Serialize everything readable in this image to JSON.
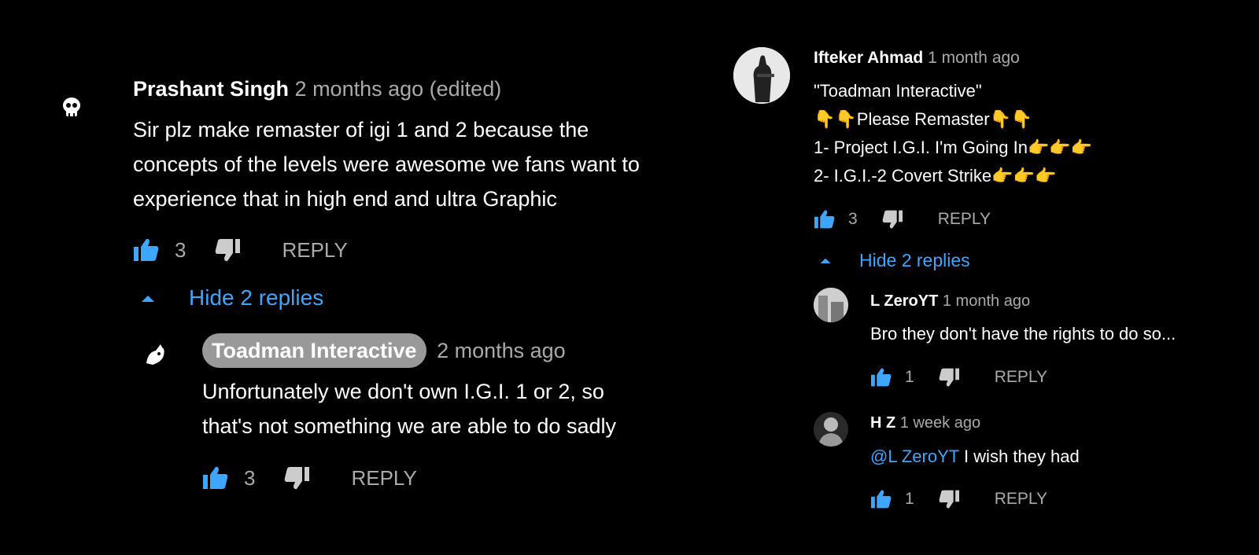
{
  "colors": {
    "accent": "#3ea6ff",
    "muted": "#aaaaaa",
    "background": "#000000",
    "chip": "#999999"
  },
  "left_thread": {
    "comment": {
      "author": "Prashant Singh",
      "meta": "2 months ago (edited)",
      "lines": [
        "Sir plz make remaster of igi 1 and 2  because the",
        "concepts of the levels were awesome we fans want to",
        "experience that in high end and ultra Graphic"
      ],
      "likes": "3",
      "reply_label": "REPLY"
    },
    "toggle_label": "Hide 2 replies",
    "reply": {
      "author": "Toadman Interactive",
      "meta": "2 months ago",
      "lines": [
        "Unfortunately we don't own I.G.I. 1 or 2, so",
        "that's not something we are able to do sadly"
      ],
      "likes": "3",
      "reply_label": "REPLY"
    }
  },
  "right_thread": {
    "comment": {
      "author": "Ifteker Ahmad",
      "meta": "1 month ago",
      "lines": [
        "\"Toadman Interactive\"",
        "👇👇Please Remaster👇👇",
        "1- Project I.G.I. I'm Going In👉👉👉",
        "2- I.G.I.-2 Covert Strike👉👉👉"
      ],
      "likes": "3",
      "reply_label": "REPLY"
    },
    "toggle_label": "Hide 2 replies",
    "replies": [
      {
        "author": "L ZeroYT",
        "meta": "1 month ago",
        "text": "Bro they don't have the rights to do so...",
        "likes": "1",
        "reply_label": "REPLY"
      },
      {
        "author": "H Z",
        "meta": "1 week ago",
        "mention": "@L ZeroYT",
        "text": " I wish they had",
        "likes": "1",
        "reply_label": "REPLY"
      }
    ]
  }
}
